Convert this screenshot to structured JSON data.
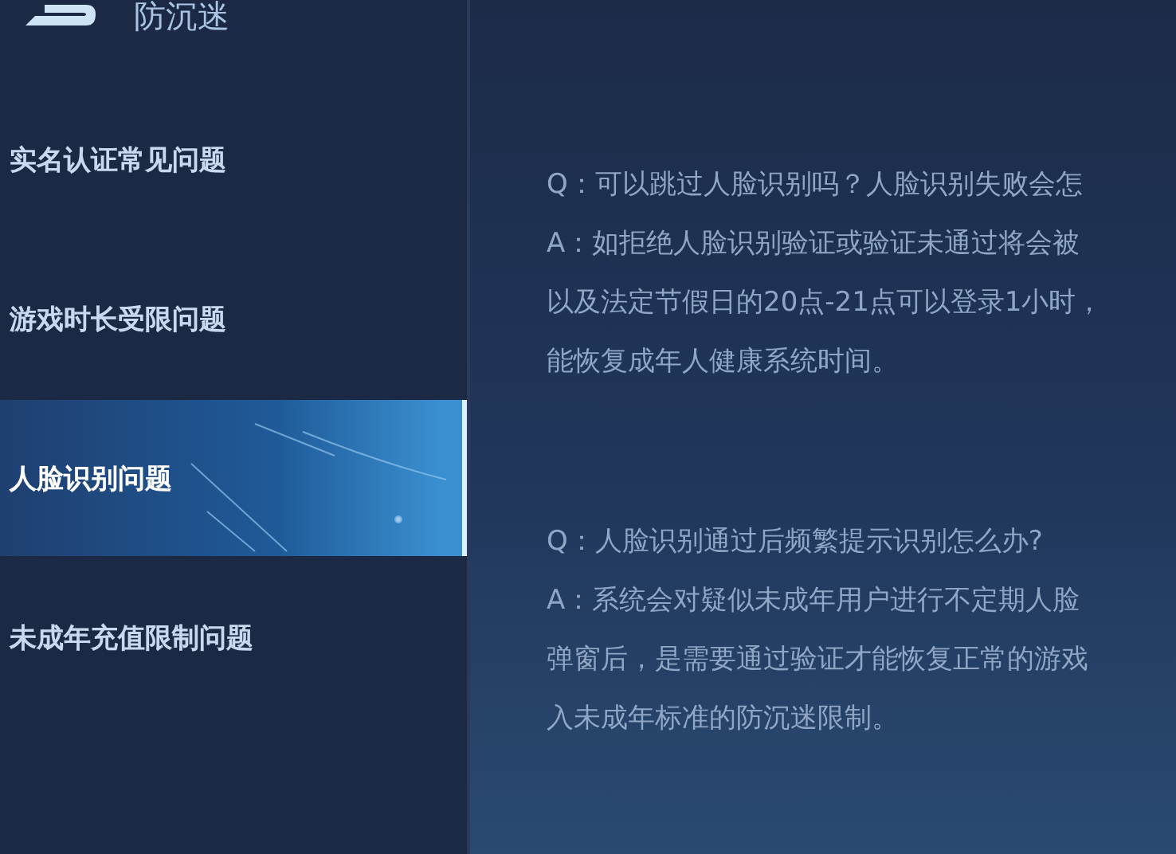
{
  "header": {
    "title": "防沉迷"
  },
  "sidebar": {
    "items": [
      {
        "label": "实名认证常见问题",
        "selected": false
      },
      {
        "label": "游戏时长受限问题",
        "selected": false
      },
      {
        "label": "人脸识别问题",
        "selected": true
      },
      {
        "label": "未成年充值限制问题",
        "selected": false
      }
    ]
  },
  "faq": [
    {
      "question": "Q：可以跳过人脸识别吗？人脸识别失败会怎",
      "answer_lines": [
        "A：如拒绝人脸识别验证或验证未通过将会被",
        "以及法定节假日的20点-21点可以登录1小时，",
        "能恢复成年人健康系统时间。"
      ]
    },
    {
      "question": "Q：人脸识别通过后频繁提示识别怎么办?",
      "answer_lines": [
        "A：系统会对疑似未成年用户进行不定期人脸",
        "弹窗后，是需要通过验证才能恢复正常的游戏",
        "入未成年标准的防沉迷限制。"
      ]
    }
  ]
}
